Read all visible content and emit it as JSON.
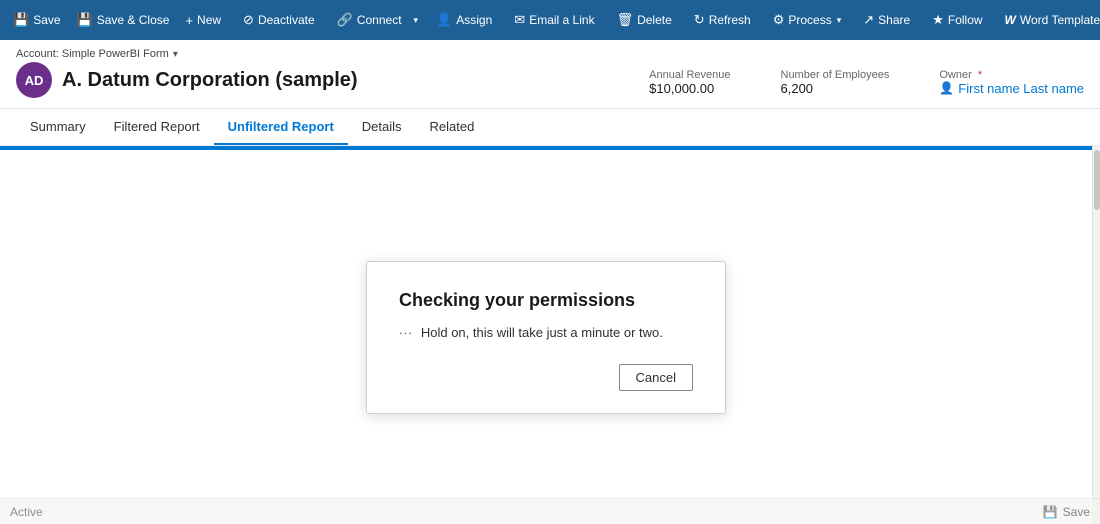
{
  "toolbar": {
    "buttons": [
      {
        "id": "save",
        "icon": "💾",
        "label": "Save",
        "has_caret": false
      },
      {
        "id": "save-close",
        "icon": "💾",
        "label": "Save & Close",
        "has_caret": false
      },
      {
        "id": "new",
        "icon": "+",
        "label": "New",
        "has_caret": false
      },
      {
        "id": "deactivate",
        "icon": "⊘",
        "label": "Deactivate",
        "has_caret": false
      },
      {
        "id": "connect",
        "icon": "🔗",
        "label": "Connect",
        "has_caret": true
      },
      {
        "id": "assign",
        "icon": "👤",
        "label": "Assign",
        "has_caret": false
      },
      {
        "id": "email-link",
        "icon": "✉",
        "label": "Email a Link",
        "has_caret": false
      },
      {
        "id": "delete",
        "icon": "🗑",
        "label": "Delete",
        "has_caret": false
      },
      {
        "id": "refresh",
        "icon": "↻",
        "label": "Refresh",
        "has_caret": false
      },
      {
        "id": "process",
        "icon": "⚙",
        "label": "Process",
        "has_caret": true
      },
      {
        "id": "share",
        "icon": "↗",
        "label": "Share",
        "has_caret": false
      },
      {
        "id": "follow",
        "icon": "★",
        "label": "Follow",
        "has_caret": false
      },
      {
        "id": "word-templates",
        "icon": "W",
        "label": "Word Templates",
        "has_caret": true
      }
    ]
  },
  "record": {
    "avatar_text": "AD",
    "form_label": "Account: Simple PowerBI Form",
    "title": "A. Datum Corporation (sample)",
    "fields": [
      {
        "id": "annual-revenue",
        "label": "Annual Revenue",
        "value": "$10,000.00",
        "is_link": false
      },
      {
        "id": "employees",
        "label": "Number of Employees",
        "value": "6,200",
        "is_link": false
      },
      {
        "id": "owner",
        "label": "Owner",
        "value": "First name Last name",
        "is_link": true,
        "required": true
      }
    ]
  },
  "tabs": [
    {
      "id": "summary",
      "label": "Summary",
      "active": false
    },
    {
      "id": "filtered-report",
      "label": "Filtered Report",
      "active": false
    },
    {
      "id": "unfiltered-report",
      "label": "Unfiltered Report",
      "active": true
    },
    {
      "id": "details",
      "label": "Details",
      "active": false
    },
    {
      "id": "related",
      "label": "Related",
      "active": false
    }
  ],
  "modal": {
    "title": "Checking your permissions",
    "message": "Hold on, this will take just a minute or two.",
    "cancel_label": "Cancel"
  },
  "footer": {
    "status": "Active",
    "save_label": "Save",
    "save_icon": "💾"
  }
}
